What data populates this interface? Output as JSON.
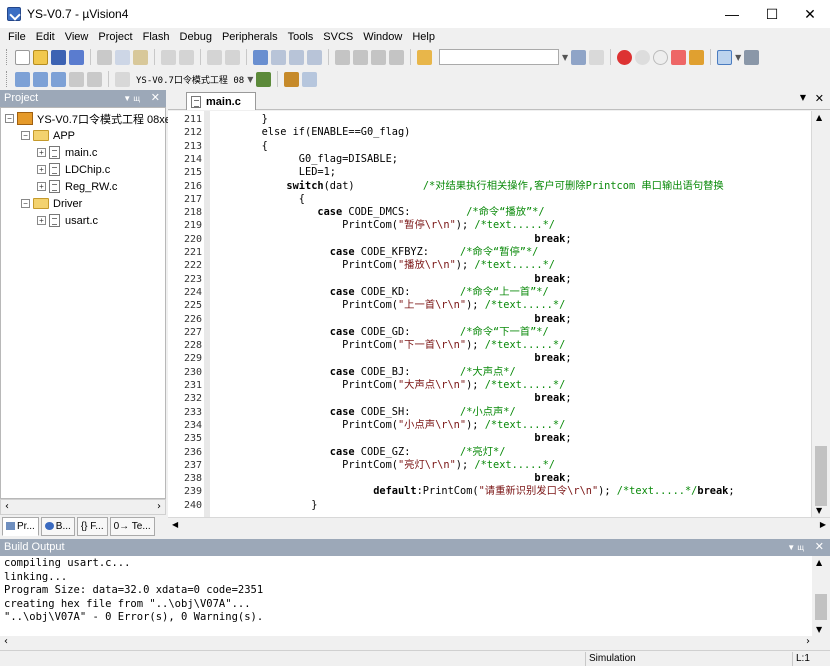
{
  "window": {
    "title": "YS-V0.7 - µVision4",
    "minimize": "—",
    "maximize": "☐",
    "close": "✕"
  },
  "menu": [
    "File",
    "Edit",
    "View",
    "Project",
    "Flash",
    "Debug",
    "Peripherals",
    "Tools",
    "SVCS",
    "Window",
    "Help"
  ],
  "toolbar2": {
    "target_select": "YS-V0.7口令模式工程 08"
  },
  "project_panel": {
    "title": "Project",
    "root": "YS-V0.7口令模式工程 08xe",
    "groups": [
      {
        "name": "APP",
        "files": [
          "main.c",
          "LDChip.c",
          "Reg_RW.c"
        ]
      },
      {
        "name": "Driver",
        "files": [
          "usart.c"
        ]
      }
    ],
    "tabs": [
      "Pr...",
      "B...",
      "{} F...",
      "0→ Te..."
    ]
  },
  "editor": {
    "tab": "main.c",
    "lines": [
      {
        "n": "211",
        "html": "        }"
      },
      {
        "n": "212",
        "html": "        else if(ENABLE==G0_flag)"
      },
      {
        "n": "213",
        "html": "        {"
      },
      {
        "n": "214",
        "html": "              G0_flag=DISABLE;"
      },
      {
        "n": "215",
        "html": "              LED=1;"
      },
      {
        "n": "216",
        "html": "            <b>switch</b>(dat)           <span class='cmt'>/*对结果执行相关操作,客户可删除Printcom 串口输出语句替换</span>"
      },
      {
        "n": "217",
        "html": "              {"
      },
      {
        "n": "218",
        "html": "                 <b>case</b> CODE_DMCS:         <span class='cmt'>/*命令“播放”*/</span>"
      },
      {
        "n": "219",
        "html": "                     PrintCom(<span class='str'>\"暂停\\r\\n\"</span>); <span class='cmt'>/*text.....*/</span>"
      },
      {
        "n": "220",
        "html": "                                                    <b>break</b>;"
      },
      {
        "n": "221",
        "html": "                   <b>case</b> CODE_KFBYZ:     <span class='cmt'>/*命令“暂停”*/</span>"
      },
      {
        "n": "222",
        "html": "                     PrintCom(<span class='str'>\"播放\\r\\n\"</span>); <span class='cmt'>/*text.....*/</span>"
      },
      {
        "n": "223",
        "html": "                                                    <b>break</b>;"
      },
      {
        "n": "224",
        "html": "                   <b>case</b> CODE_KD:        <span class='cmt'>/*命令“上一首”*/</span>"
      },
      {
        "n": "225",
        "html": "                     PrintCom(<span class='str'>\"上一首\\r\\n\"</span>); <span class='cmt'>/*text.....*/</span>"
      },
      {
        "n": "226",
        "html": "                                                    <b>break</b>;"
      },
      {
        "n": "227",
        "html": "                   <b>case</b> CODE_GD:        <span class='cmt'>/*命令“下一首”*/</span>"
      },
      {
        "n": "228",
        "html": "                     PrintCom(<span class='str'>\"下一首\\r\\n\"</span>); <span class='cmt'>/*text.....*/</span>"
      },
      {
        "n": "229",
        "html": "                                                    <b>break</b>;"
      },
      {
        "n": "230",
        "html": "                   <b>case</b> CODE_BJ:        <span class='cmt'>/*大声点*/</span>"
      },
      {
        "n": "231",
        "html": "                     PrintCom(<span class='str'>\"大声点\\r\\n\"</span>); <span class='cmt'>/*text.....*/</span>"
      },
      {
        "n": "232",
        "html": "                                                    <b>break</b>;"
      },
      {
        "n": "233",
        "html": "                   <b>case</b> CODE_SH:        <span class='cmt'>/*小点声*/</span>"
      },
      {
        "n": "234",
        "html": "                     PrintCom(<span class='str'>\"小点声\\r\\n\"</span>); <span class='cmt'>/*text.....*/</span>"
      },
      {
        "n": "235",
        "html": "                                                    <b>break</b>;"
      },
      {
        "n": "236",
        "html": "                   <b>case</b> CODE_GZ:        <span class='cmt'>/*亮灯*/</span>"
      },
      {
        "n": "237",
        "html": "                     PrintCom(<span class='str'>\"亮灯\\r\\n\"</span>); <span class='cmt'>/*text.....*/</span>"
      },
      {
        "n": "238",
        "html": "                                                    <b>break</b>;"
      },
      {
        "n": "239",
        "html": "                          <b>default</b>:PrintCom(<span class='str'>\"请重新识别发口令\\r\\n\"</span>); <span class='cmt'>/*text.....*/</span><b>break</b>;"
      },
      {
        "n": "240",
        "html": "                }"
      }
    ]
  },
  "build_output": {
    "title": "Build Output",
    "lines": [
      "compiling usart.c...",
      "linking...",
      "Program Size: data=32.0 xdata=0 code=2351",
      "creating hex file from \"..\\obj\\V07A\"...",
      "\"..\\obj\\V07A\" - 0 Error(s), 0 Warning(s)."
    ]
  },
  "status": {
    "mode": "Simulation",
    "line": "L:1"
  }
}
